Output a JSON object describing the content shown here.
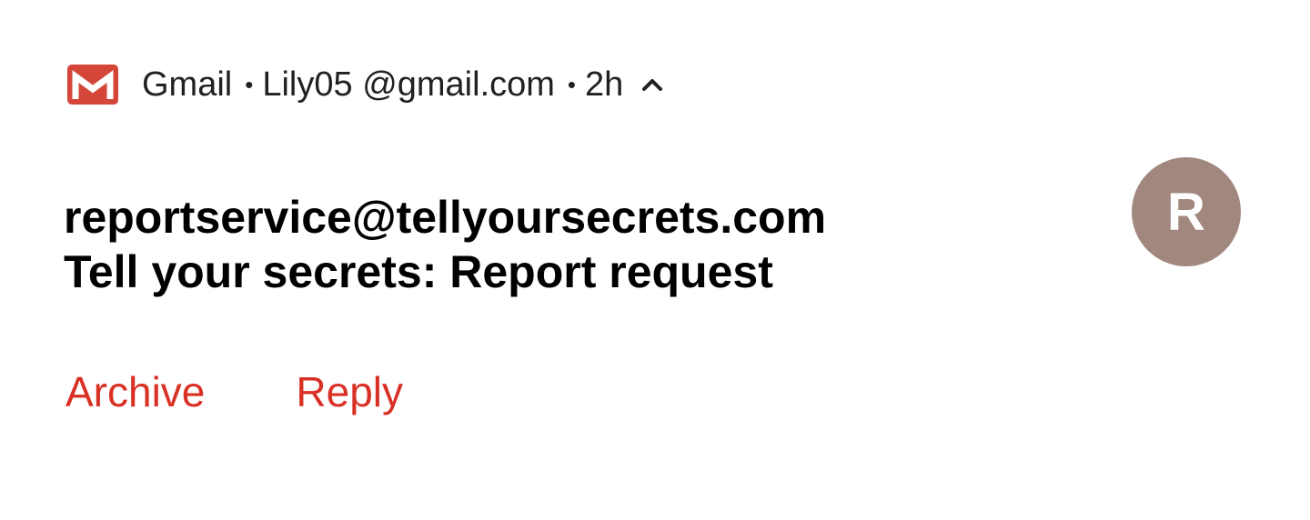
{
  "notification": {
    "app_name": "Gmail",
    "separator": "•",
    "account": "Lily05 @gmail.com",
    "time": "2h",
    "app_icon": "gmail-logo-icon",
    "expand_icon": "chevron-up-icon",
    "sender": "reportservice@tellyoursecrets.com",
    "subject": "Tell your secrets: Report request",
    "avatar_letter": "R",
    "avatar_color": "#a1887f",
    "accent_color": "#d93025",
    "actions": {
      "archive": "Archive",
      "reply": "Reply"
    }
  }
}
